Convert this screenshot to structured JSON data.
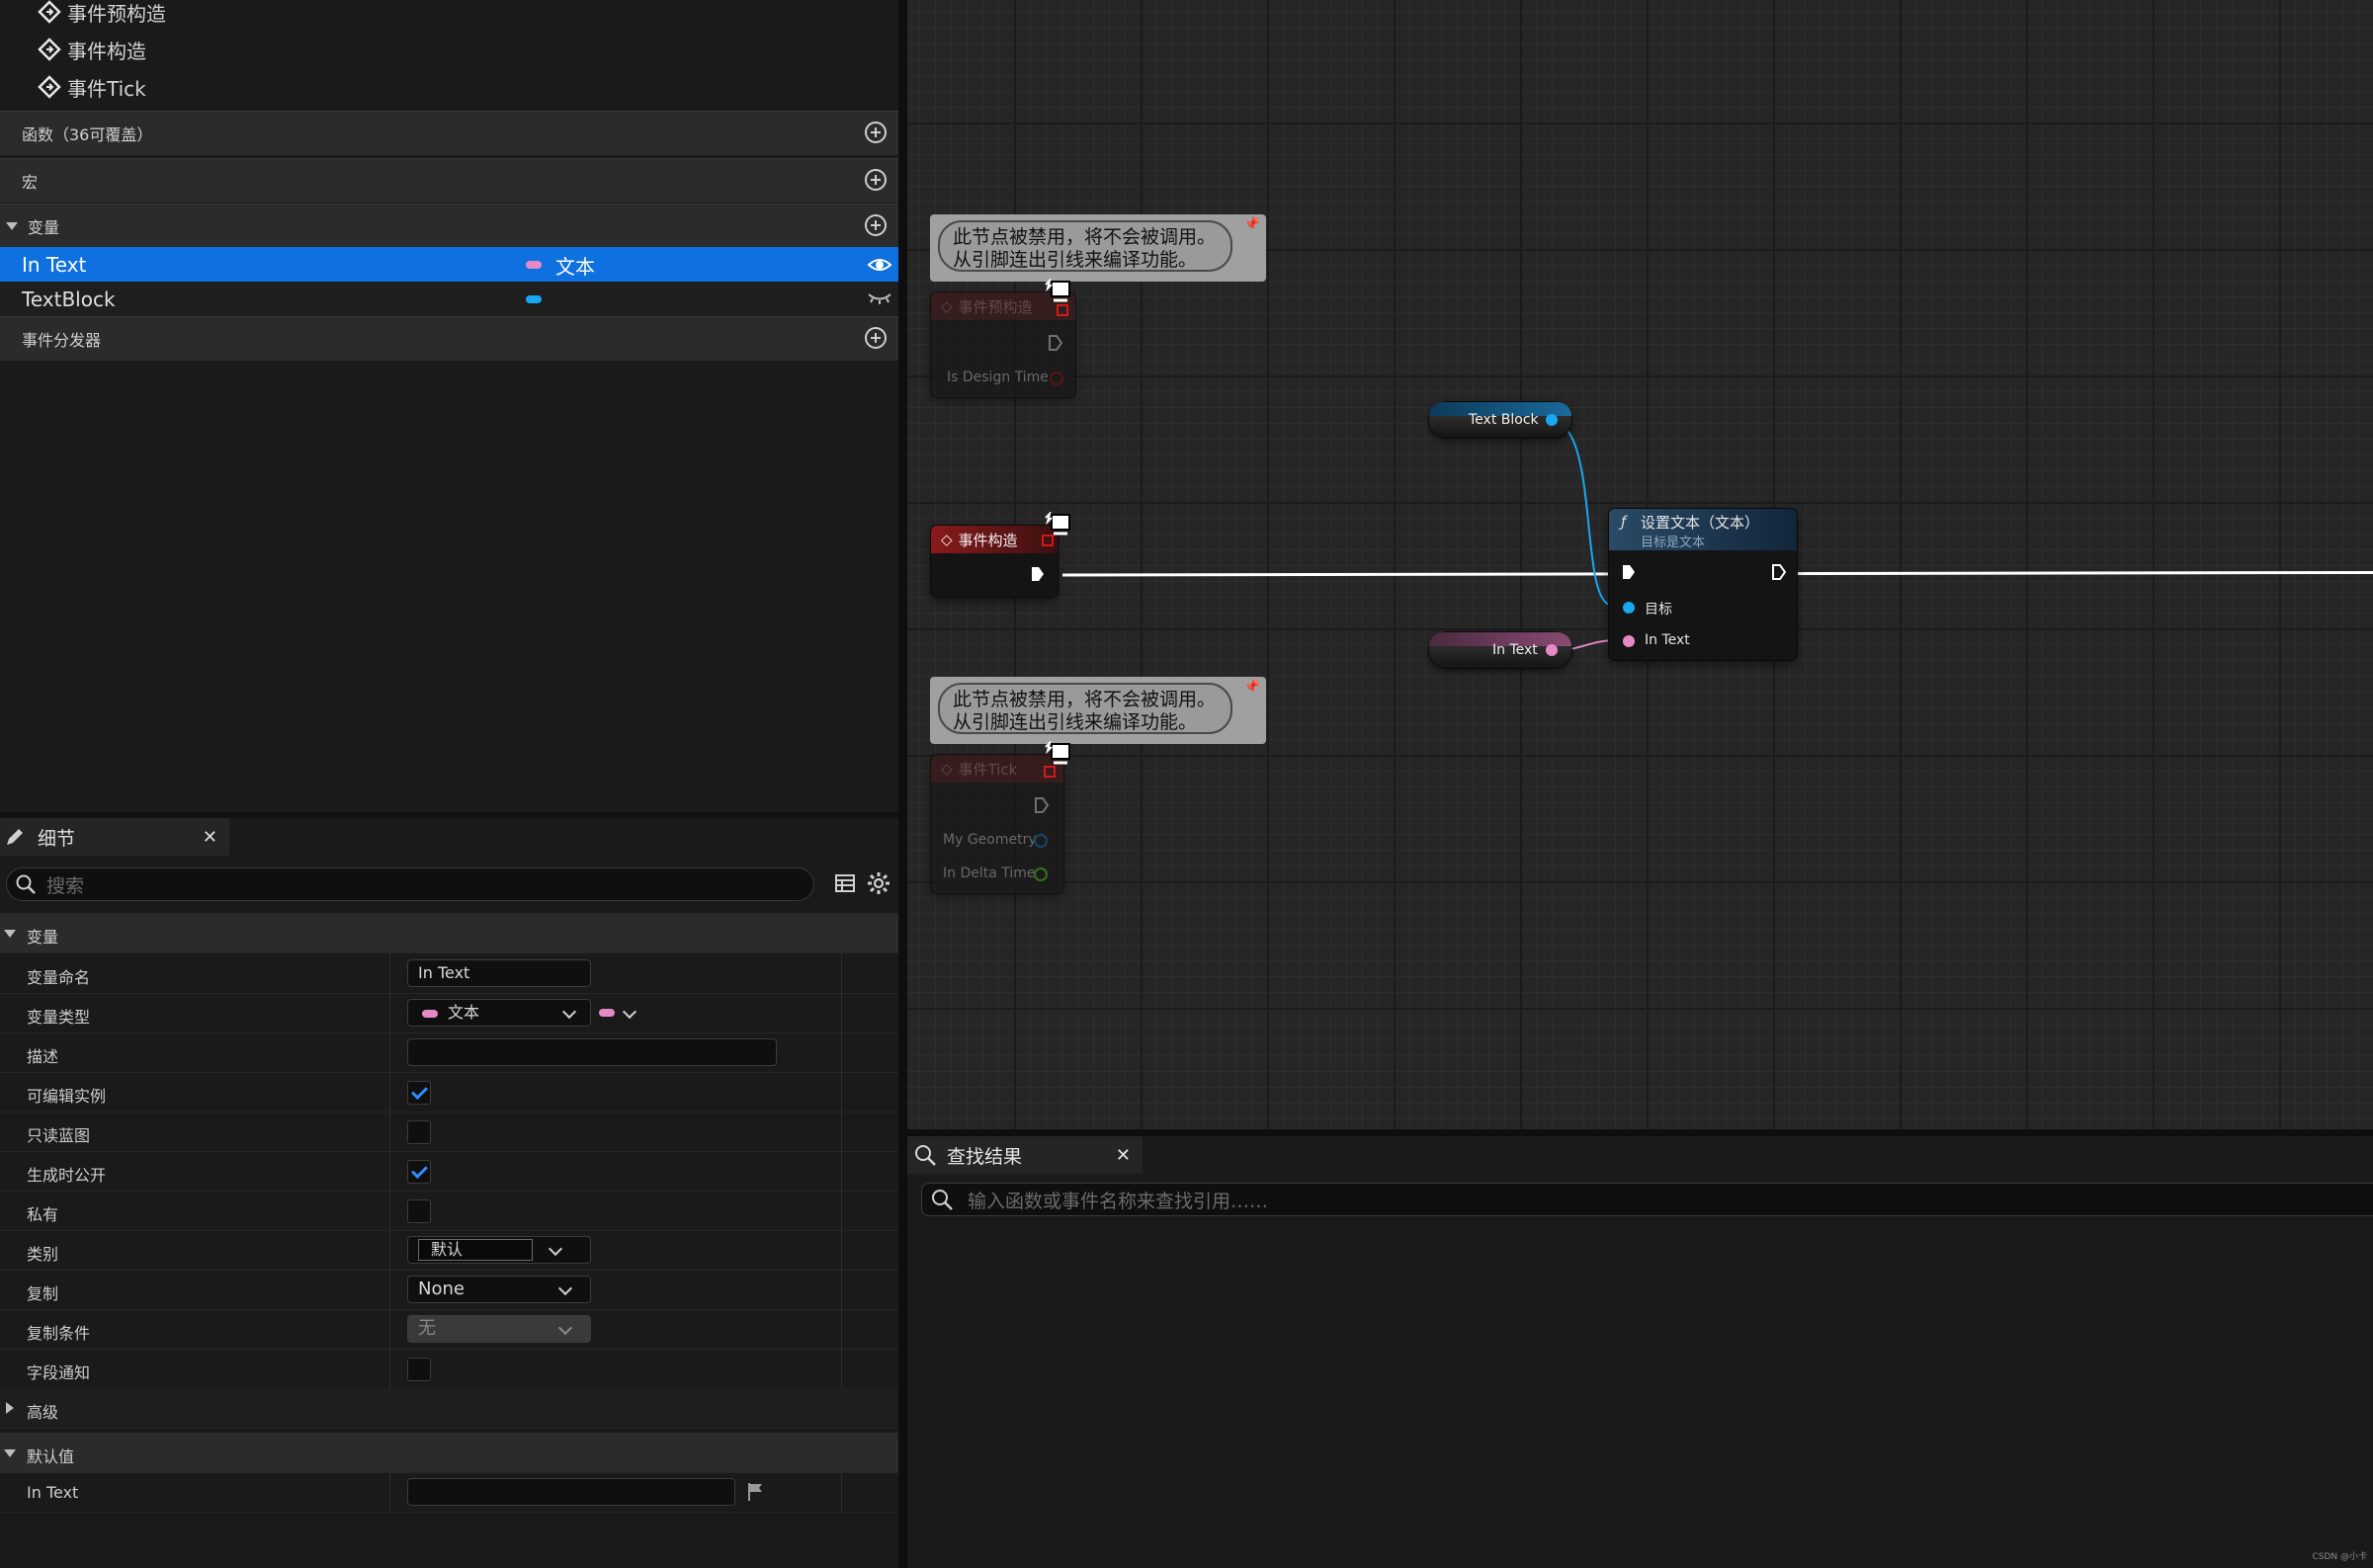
{
  "myblueprint": {
    "events": [
      "事件预构造",
      "事件构造",
      "事件Tick"
    ],
    "sections": {
      "functions": "函数（36可覆盖）",
      "macros": "宏",
      "variables": "变量",
      "dispatchers": "事件分发器"
    },
    "variables": [
      {
        "name": "In Text",
        "type": "文本",
        "color": "#e58ac6",
        "selected": true
      },
      {
        "name": "TextBlock",
        "type": "",
        "color": "#18a8f0",
        "selected": false
      }
    ]
  },
  "details": {
    "tab_title": "细节",
    "search_placeholder": "搜索",
    "category_variable": "变量",
    "labels": {
      "name": "变量命名",
      "type": "变量类型",
      "description": "描述",
      "instance_editable": "可编辑实例",
      "blueprint_readonly": "只读蓝图",
      "expose_on_spawn": "生成时公开",
      "private": "私有",
      "category": "类别",
      "replication": "复制",
      "replication_condition": "复制条件",
      "field_notify": "字段通知"
    },
    "values": {
      "name": "In Text",
      "type": "文本",
      "description": "",
      "instance_editable": true,
      "blueprint_readonly": false,
      "expose_on_spawn": true,
      "private": false,
      "category": "默认",
      "replication": "None",
      "replication_condition": "无",
      "field_notify": false
    },
    "advanced": "高级",
    "default_value_section": "默认值",
    "default_value_label": "In Text",
    "default_value": ""
  },
  "graph": {
    "disabled_comment_line1": "此节点被禁用，将不会被调用。",
    "disabled_comment_line2": "从引脚连出引线来编译功能。",
    "node_preconstruct": {
      "title": "事件预构造",
      "pin": "Is Design Time"
    },
    "node_construct": {
      "title": "事件构造"
    },
    "node_tick": {
      "title": "事件Tick",
      "pins": [
        "My Geometry",
        "In Delta Time"
      ]
    },
    "var_textblock": "Text Block",
    "var_intext": "In Text",
    "settext": {
      "title": "设置文本（文本）",
      "subtitle": "目标是文本",
      "pin_target": "目标",
      "pin_text": "In Text"
    },
    "exec_color": "#ffffff",
    "object_color": "#18a8f0",
    "text_color": "#e58ac6"
  },
  "find": {
    "tab_title": "查找结果",
    "placeholder": "输入函数或事件名称来查找引用……"
  },
  "watermark": "CSDN @小卡"
}
